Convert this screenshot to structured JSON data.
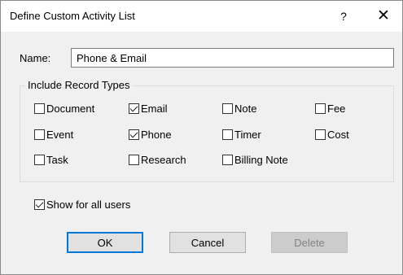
{
  "dialog": {
    "title": "Define Custom Activity List",
    "help_glyph": "?",
    "close_glyph": "✕"
  },
  "name_field": {
    "label": "Name:",
    "value": "Phone & Email"
  },
  "record_types": {
    "group_label": "Include Record Types",
    "items": [
      {
        "label": "Document",
        "checked": false
      },
      {
        "label": "Email",
        "checked": true
      },
      {
        "label": "Note",
        "checked": false
      },
      {
        "label": "Fee",
        "checked": false
      },
      {
        "label": "Event",
        "checked": false
      },
      {
        "label": "Phone",
        "checked": true
      },
      {
        "label": "Timer",
        "checked": false
      },
      {
        "label": "Cost",
        "checked": false
      },
      {
        "label": "Task",
        "checked": false
      },
      {
        "label": "Research",
        "checked": false
      },
      {
        "label": "Billing Note",
        "checked": false
      }
    ]
  },
  "show_all_users": {
    "label": "Show for all users",
    "checked": true
  },
  "buttons": {
    "ok": "OK",
    "cancel": "Cancel",
    "delete": "Delete"
  },
  "colors": {
    "accent": "#0078d7",
    "dialog_bg": "#f0f0f0",
    "titlebar_bg": "#ffffff",
    "disabled_text": "#838383"
  },
  "icons": {
    "help": "help-icon",
    "close": "close-icon",
    "checkmark": "checkmark-icon"
  }
}
